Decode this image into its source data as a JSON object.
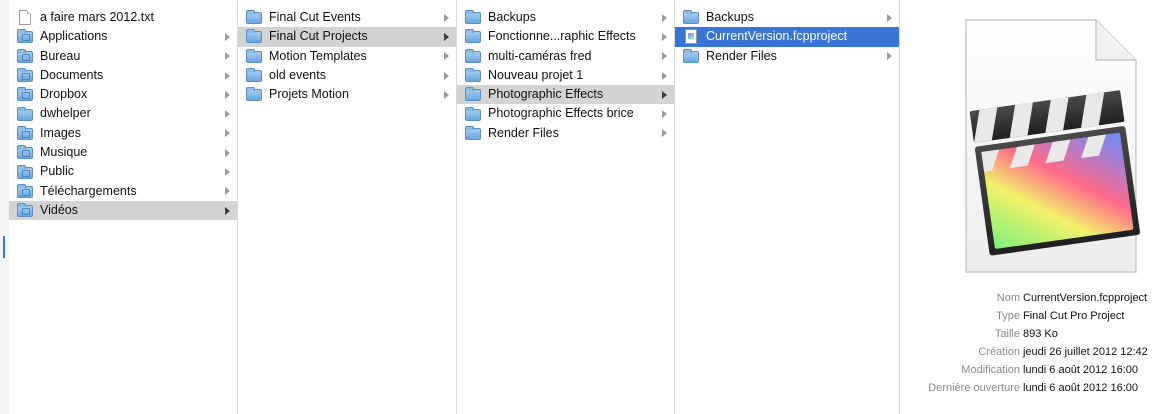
{
  "columns": [
    {
      "items": [
        {
          "label": "a faire mars 2012.txt",
          "icon": "document-icon",
          "arrow": false,
          "state": "none"
        },
        {
          "label": "Applications",
          "icon": "applications-folder-icon",
          "arrow": true,
          "state": "none"
        },
        {
          "label": "Bureau",
          "icon": "desktop-folder-icon",
          "arrow": true,
          "state": "none"
        },
        {
          "label": "Documents",
          "icon": "documents-folder-icon",
          "arrow": true,
          "state": "none"
        },
        {
          "label": "Dropbox",
          "icon": "dropbox-folder-icon",
          "arrow": true,
          "state": "none"
        },
        {
          "label": "dwhelper",
          "icon": "folder-icon",
          "arrow": true,
          "state": "none"
        },
        {
          "label": "Images",
          "icon": "pictures-folder-icon",
          "arrow": true,
          "state": "none"
        },
        {
          "label": "Musique",
          "icon": "music-folder-icon",
          "arrow": true,
          "state": "none"
        },
        {
          "label": "Public",
          "icon": "public-folder-icon",
          "arrow": true,
          "state": "none"
        },
        {
          "label": "Téléchargements",
          "icon": "downloads-folder-icon",
          "arrow": true,
          "state": "none"
        },
        {
          "label": "Vidéos",
          "icon": "movies-folder-icon",
          "arrow": true,
          "state": "path"
        }
      ]
    },
    {
      "items": [
        {
          "label": "Final Cut Events",
          "icon": "folder-icon",
          "arrow": true,
          "state": "none"
        },
        {
          "label": "Final Cut Projects",
          "icon": "folder-icon",
          "arrow": true,
          "state": "path"
        },
        {
          "label": "Motion Templates",
          "icon": "folder-icon",
          "arrow": true,
          "state": "none"
        },
        {
          "label": "old events",
          "icon": "folder-icon",
          "arrow": true,
          "state": "none"
        },
        {
          "label": "Projets Motion",
          "icon": "folder-icon",
          "arrow": true,
          "state": "none"
        }
      ]
    },
    {
      "items": [
        {
          "label": "Backups",
          "icon": "folder-icon",
          "arrow": true,
          "state": "none"
        },
        {
          "label": "Fonctionne...raphic Effects",
          "icon": "folder-icon",
          "arrow": true,
          "state": "none"
        },
        {
          "label": "multi-caméras fred",
          "icon": "folder-icon",
          "arrow": true,
          "state": "none"
        },
        {
          "label": "Nouveau projet 1",
          "icon": "folder-icon",
          "arrow": true,
          "state": "none"
        },
        {
          "label": "Photographic Effects",
          "icon": "folder-icon",
          "arrow": true,
          "state": "path"
        },
        {
          "label": "Photographic Effects brice",
          "icon": "folder-icon",
          "arrow": true,
          "state": "none"
        },
        {
          "label": "Render Files",
          "icon": "folder-icon",
          "arrow": true,
          "state": "none"
        }
      ]
    },
    {
      "items": [
        {
          "label": "Backups",
          "icon": "folder-icon",
          "arrow": true,
          "state": "none"
        },
        {
          "label": "CurrentVersion.fcpproject",
          "icon": "fcp-project-file-icon",
          "arrow": false,
          "state": "selected"
        },
        {
          "label": "Render Files",
          "icon": "folder-icon",
          "arrow": true,
          "state": "none"
        }
      ]
    }
  ],
  "preview": {
    "icon": "final-cut-pro-project-icon",
    "info": [
      {
        "key": "Nom",
        "value": "CurrentVersion.fcpproject"
      },
      {
        "key": "Type",
        "value": "Final Cut Pro Project"
      },
      {
        "key": "Taille",
        "value": "893 Ko"
      },
      {
        "key": "Création",
        "value": "jeudi 26 juillet 2012 12:42"
      },
      {
        "key": "Modification",
        "value": "lundi 6 août 2012 16:00"
      },
      {
        "key": "Dernière ouverture",
        "value": "lundi 6 août 2012 16:00"
      }
    ]
  },
  "colors": {
    "selection_blue": "#3875d7",
    "path_gray": "#d3d3d3",
    "folder_blue": "#6aa6dd"
  }
}
